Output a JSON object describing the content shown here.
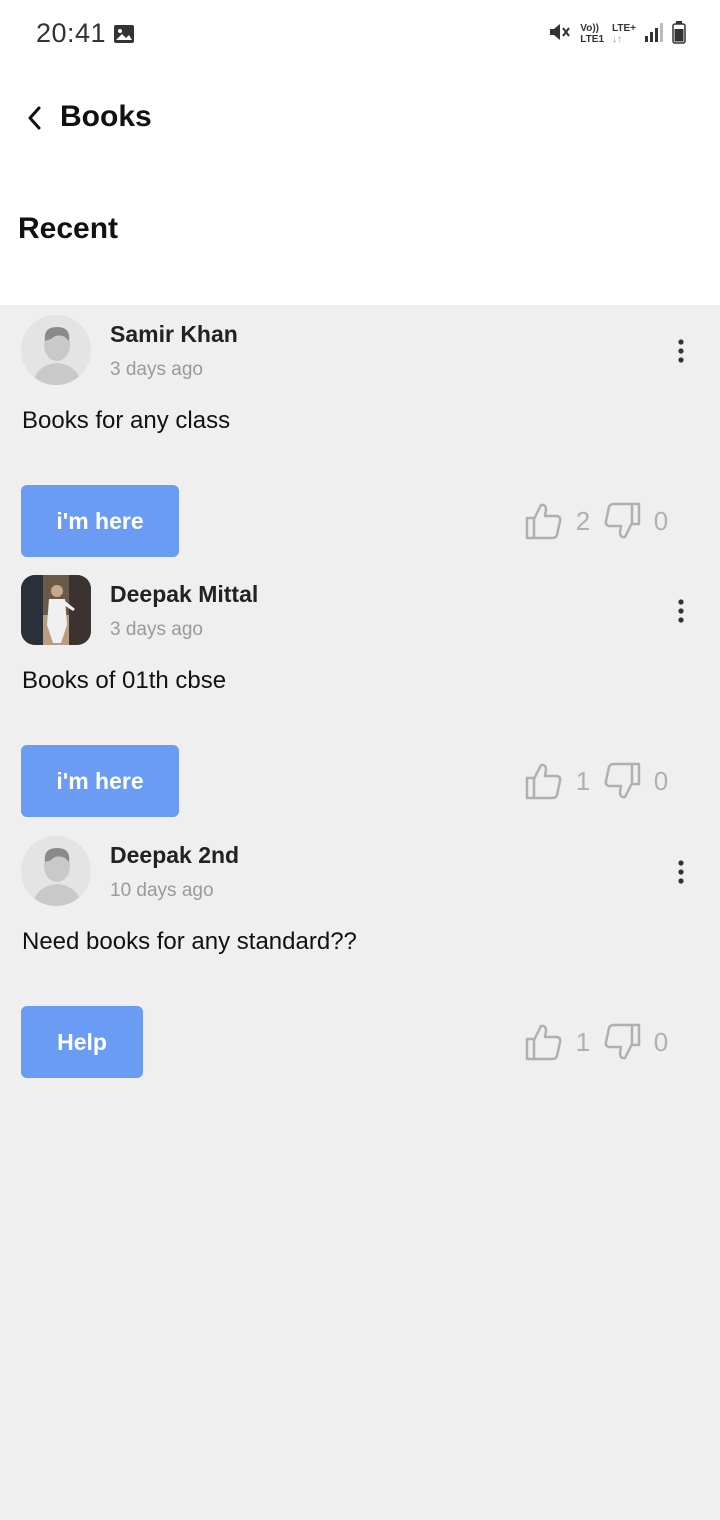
{
  "status_bar": {
    "time": "20:41",
    "volte_top": "Vo))",
    "volte_bottom": "LTE1",
    "lte_top": "LTE+",
    "lte_bottom": "↓↑",
    "icons": [
      "gallery-icon",
      "mute-icon",
      "signal-icon",
      "battery-icon"
    ]
  },
  "header": {
    "title": "Books",
    "back_icon": "chevron-left-icon"
  },
  "section": {
    "title": "Recent"
  },
  "posts": [
    {
      "author": "Samir Khan",
      "time": "3 days ago",
      "text": "Books for any class",
      "button": "i'm here",
      "likes": "2",
      "dislikes": "0"
    },
    {
      "author": "Deepak Mittal",
      "time": "3 days ago",
      "text": "Books of 01th cbse",
      "button": "i'm here",
      "likes": "1",
      "dislikes": "0"
    },
    {
      "author": "Deepak 2nd",
      "time": "10 days ago",
      "text": "Need books for any standard??",
      "button": "Help",
      "likes": "1",
      "dislikes": "0"
    }
  ],
  "colors": {
    "accent": "#6a9cf4",
    "background": "#efefef",
    "muted": "#9a9a9a"
  }
}
